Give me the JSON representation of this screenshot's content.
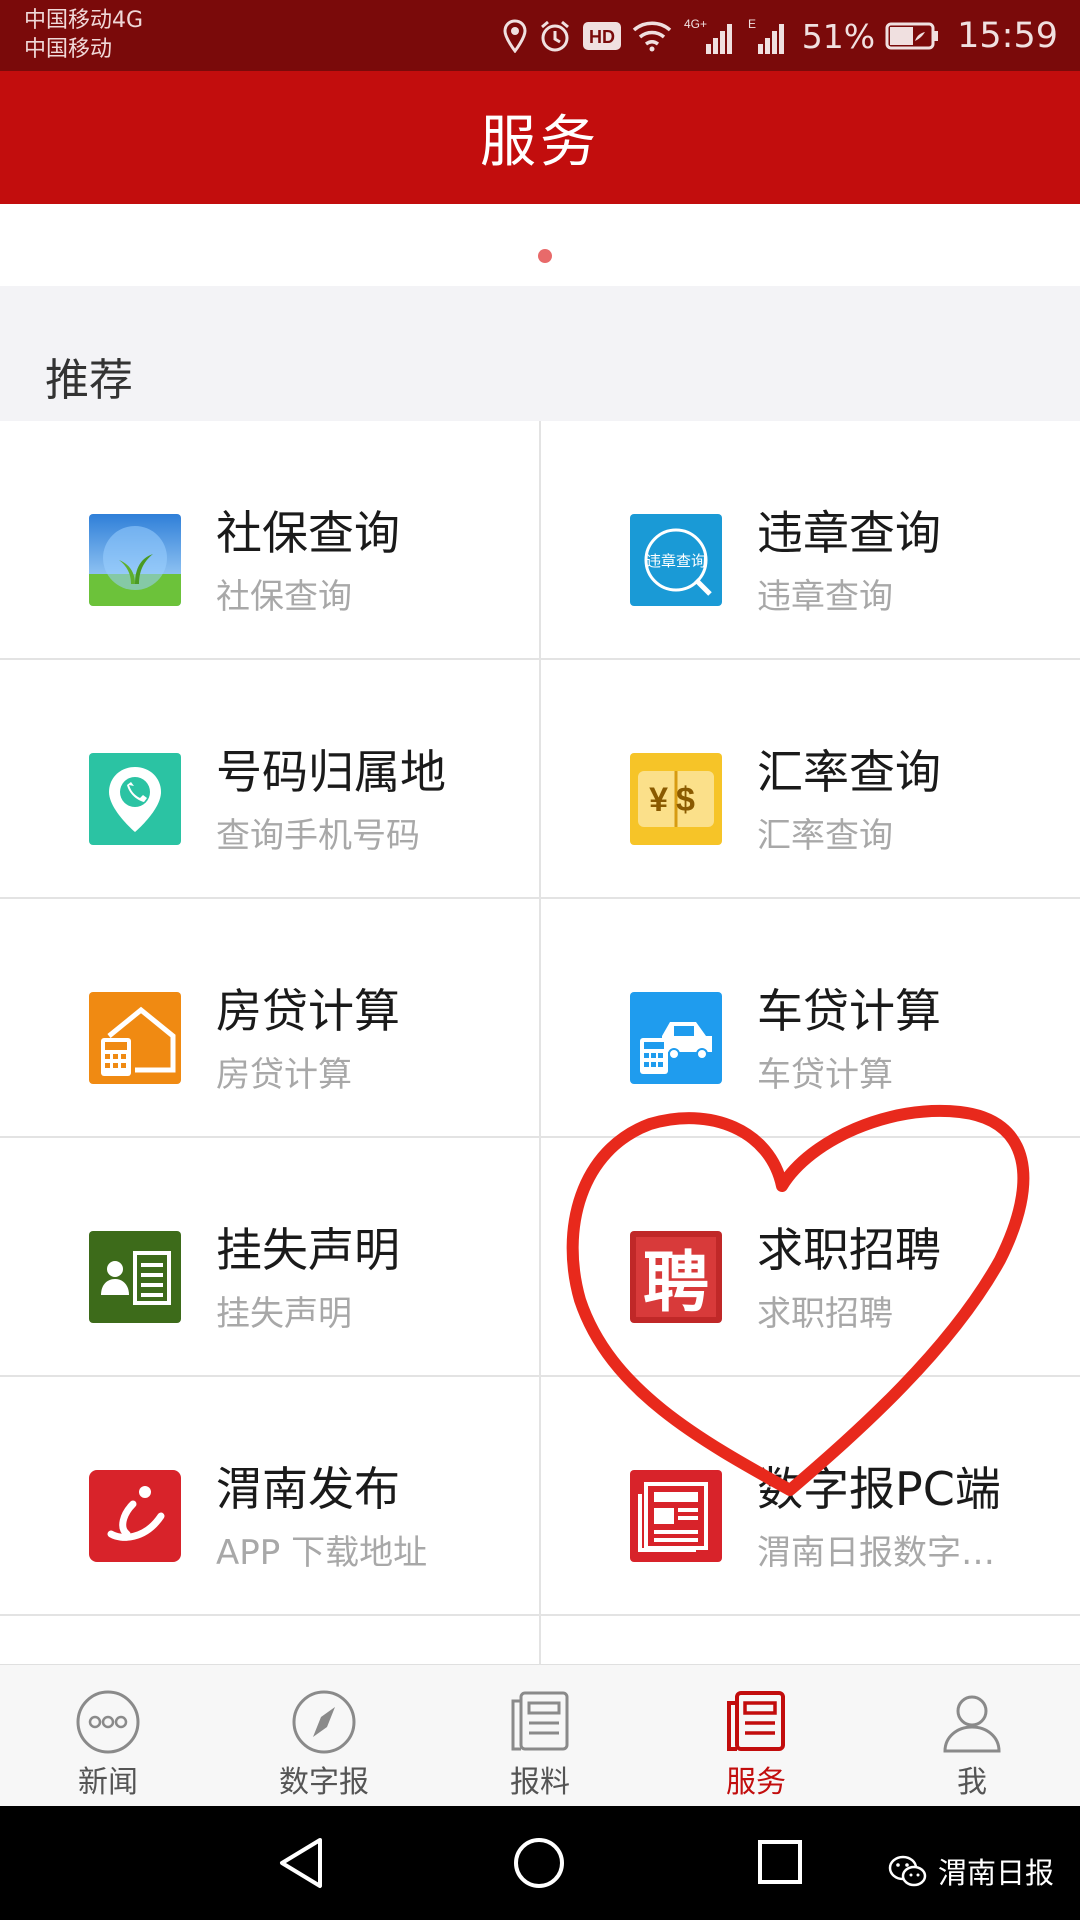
{
  "status_bar": {
    "carrier_line1": "中国移动4G",
    "carrier_line2": "中国移动",
    "hd_badge": "HD",
    "net_type_1": "4G+",
    "net_type_2": "E",
    "battery_percent": "51%",
    "time": "15:59"
  },
  "header": {
    "title": "服务"
  },
  "section": {
    "title": "推荐"
  },
  "services": [
    {
      "title": "社保查询",
      "subtitle": "社保查询",
      "icon": "social-security-icon"
    },
    {
      "title": "违章查询",
      "subtitle": "违章查询",
      "icon": "traffic-violation-icon",
      "icon_text": "违章查询"
    },
    {
      "title": "号码归属地",
      "subtitle": "查询手机号码",
      "icon": "phone-location-icon"
    },
    {
      "title": "汇率查询",
      "subtitle": "汇率查询",
      "icon": "exchange-rate-icon",
      "icon_text": "¥$"
    },
    {
      "title": "房贷计算",
      "subtitle": "房贷计算",
      "icon": "mortgage-calculator-icon"
    },
    {
      "title": "车贷计算",
      "subtitle": "车贷计算",
      "icon": "car-loan-calculator-icon"
    },
    {
      "title": "挂失声明",
      "subtitle": "挂失声明",
      "icon": "lost-notice-icon"
    },
    {
      "title": "求职招聘",
      "subtitle": "求职招聘",
      "icon": "recruitment-icon",
      "icon_text": "聘"
    },
    {
      "title": "渭南发布",
      "subtitle": "APP 下载地址",
      "icon": "weinan-release-icon"
    },
    {
      "title": "数字报PC端",
      "subtitle": "渭南日报数字…",
      "icon": "digital-paper-pc-icon"
    }
  ],
  "tabs": [
    {
      "label": "新闻",
      "icon": "news-dots-icon",
      "active": false
    },
    {
      "label": "数字报",
      "icon": "compass-icon",
      "active": false
    },
    {
      "label": "报料",
      "icon": "report-icon",
      "active": false
    },
    {
      "label": "服务",
      "icon": "service-icon",
      "active": true
    },
    {
      "label": "我",
      "icon": "person-icon",
      "active": false
    }
  ],
  "watermark": {
    "text": "渭南日报"
  },
  "colors": {
    "header_red": "#c20d0d",
    "status_bar": "#7a0a0a",
    "annotation_red": "#e8291c"
  }
}
